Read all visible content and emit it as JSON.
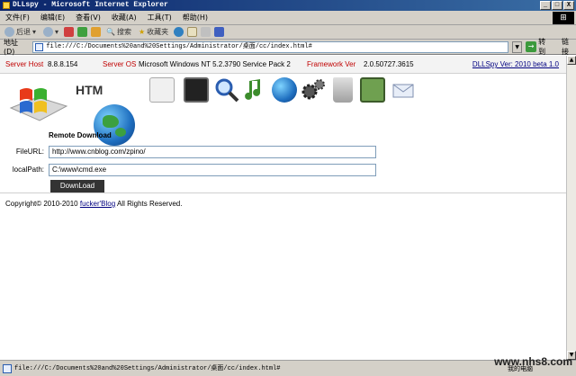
{
  "window": {
    "title": "DLLspy - Microsoft Internet Explorer",
    "min": "_",
    "max": "□",
    "close": "X"
  },
  "menu": {
    "items": [
      "文件(F)",
      "编辑(E)",
      "查看(V)",
      "收藏(A)",
      "工具(T)",
      "帮助(H)"
    ]
  },
  "toolbar": {
    "back": "后退",
    "search": "搜索",
    "favorites": "收藏夹"
  },
  "address": {
    "label": "地址(D)",
    "url": "file:///C:/Documents%20and%20Settings/Administrator/桌面/cc/index.html#",
    "go": "转到",
    "links": "链接"
  },
  "info": {
    "server_host_label": "Server Host",
    "server_host_value": "8.8.8.154",
    "server_os_label": "Server OS",
    "server_os_value": "Microsoft Windows NT 5.2.3790 Service Pack 2",
    "framework_label": "Framework Ver",
    "framework_value": "2.0.50727.3615",
    "version_link": "DLLSpy Ver: 2010 beta 1.0"
  },
  "logo": {
    "htm": "HTM"
  },
  "form": {
    "title": "Remote Download",
    "fileurl_label": "FileURL:",
    "fileurl_value": "http://www.cnblog.com/zpino/",
    "localpath_label": "localPath:",
    "localpath_value": "C:\\www\\cmd.exe",
    "download_label": "DownLoad"
  },
  "footer": {
    "prefix": "Copyright© 2010-2010",
    "link": "fucker'Blog",
    "suffix": "All Rights Reserved."
  },
  "status": {
    "url": "file:///C:/Documents%20and%20Settings/Administrator/桌面/cc/index.html#",
    "zone": "我的电脑",
    "watermark": "www.nhs8.com"
  },
  "colors": {
    "label_red": "#c00000",
    "link_blue": "#000080",
    "title_blue": "#0a246a"
  }
}
